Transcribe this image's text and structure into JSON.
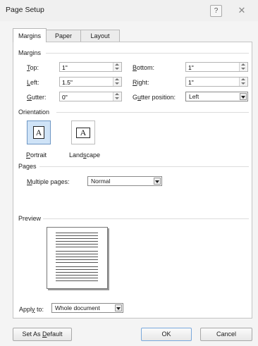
{
  "window": {
    "title": "Page Setup",
    "help_glyph": "?",
    "close_glyph": "✕"
  },
  "tabs": [
    {
      "label": "Margins",
      "active": true
    },
    {
      "label": "Paper",
      "active": false
    },
    {
      "label": "Layout",
      "active": false
    }
  ],
  "margins": {
    "section": "Margins",
    "top": {
      "label_u": "T",
      "label_rest": "op:",
      "value": "1\""
    },
    "bottom": {
      "label_u": "B",
      "label_rest": "ottom:",
      "value": "1\""
    },
    "left": {
      "label_u": "L",
      "label_rest": "eft:",
      "value": "1.5\""
    },
    "right": {
      "label_u": "R",
      "label_rest": "ight:",
      "value": "1\""
    },
    "gutter": {
      "label_u": "G",
      "label_rest": "utter:",
      "value": "0\""
    },
    "gutter_position": {
      "label_pre": "G",
      "label_u": "u",
      "label_rest": "tter position:",
      "value": "Left"
    }
  },
  "orientation": {
    "section": "Orientation",
    "portrait": {
      "label_u": "P",
      "label_rest": "ortrait",
      "glyph": "A",
      "selected": true
    },
    "landscape": {
      "label_pre": "Land",
      "label_u": "s",
      "label_rest": "cape",
      "glyph": "A",
      "selected": false
    }
  },
  "pages": {
    "section": "Pages",
    "multiple_label_u": "M",
    "multiple_label_rest": "ultiple pages:",
    "multiple_value": "Normal"
  },
  "preview": {
    "section": "Preview"
  },
  "apply": {
    "label_pre": "Appl",
    "label_u": "y",
    "label_rest": " to:",
    "value": "Whole document"
  },
  "buttons": {
    "default_pre": "Set As ",
    "default_u": "D",
    "default_rest": "efault",
    "ok": "OK",
    "cancel": "Cancel"
  },
  "icons": {
    "spin": "spin-arrows-icon",
    "dropdown": "chevron-down-icon"
  }
}
